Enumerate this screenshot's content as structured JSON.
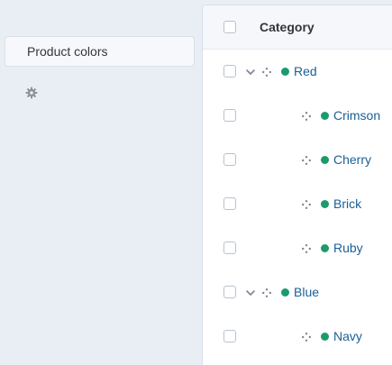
{
  "sidebar": {
    "items": [
      {
        "label": "Product colors"
      }
    ],
    "settings_icon": "gear-icon"
  },
  "table": {
    "header": {
      "label": "Category"
    },
    "rows": [
      {
        "label": "Red",
        "level": 0,
        "expanded": true,
        "status_color": "#1b9b6b"
      },
      {
        "label": "Crimson",
        "level": 1,
        "status_color": "#1b9b6b"
      },
      {
        "label": "Cherry",
        "level": 1,
        "status_color": "#1b9b6b"
      },
      {
        "label": "Brick",
        "level": 1,
        "status_color": "#1b9b6b"
      },
      {
        "label": "Ruby",
        "level": 1,
        "status_color": "#1b9b6b"
      },
      {
        "label": "Blue",
        "level": 0,
        "expanded": true,
        "status_color": "#1b9b6b"
      },
      {
        "label": "Navy",
        "level": 1,
        "status_color": "#1b9b6b"
      }
    ]
  },
  "colors": {
    "link": "#1a5f96",
    "status": "#1b9b6b",
    "background": "#e9eef5"
  }
}
